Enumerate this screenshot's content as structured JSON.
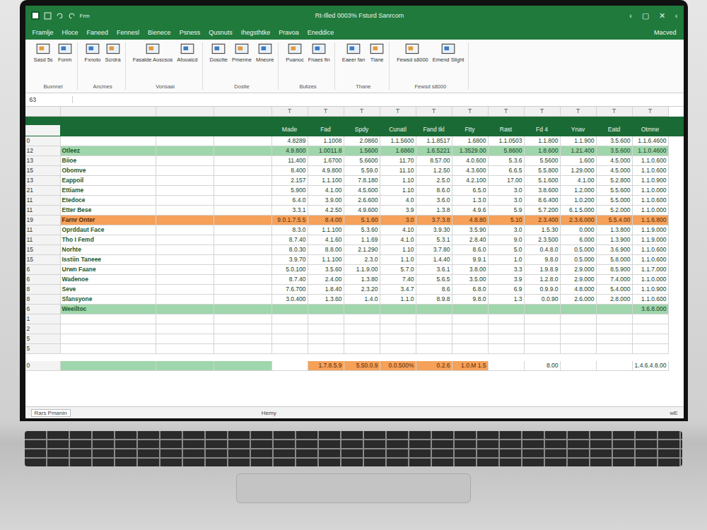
{
  "window": {
    "title": "Rt-Illed 0003% Fsturd Sanrcom",
    "controls": [
      "‹",
      "▢",
      "✕",
      "‹"
    ],
    "account": "Macved"
  },
  "quick_access": [
    "Frm"
  ],
  "tabs": [
    {
      "label": "Framlje",
      "selected": false
    },
    {
      "label": "Hloce",
      "selected": false
    },
    {
      "label": "Faneed",
      "selected": false
    },
    {
      "label": "Fennesl",
      "selected": false
    },
    {
      "label": "Bienece",
      "selected": false
    },
    {
      "label": "Psness",
      "selected": false
    },
    {
      "label": "Qusnuts",
      "selected": false
    },
    {
      "label": "Ihegsthtke",
      "selected": false
    },
    {
      "label": "Pravoa",
      "selected": false
    },
    {
      "label": "Eneddice",
      "selected": false
    }
  ],
  "ribbon": [
    {
      "group": "Buxnnel",
      "items": [
        "Sasd 5s",
        "Fonm"
      ]
    },
    {
      "group": "Ancmes",
      "items": [
        "Fxnoto",
        "Scrdra"
      ]
    },
    {
      "group": "Vonsaai",
      "items": [
        "Fasalde Aoscsos",
        "Afooaicd"
      ]
    },
    {
      "group": "Dostie",
      "items": [
        "Dosctte",
        "Pmenne",
        "Mneore"
      ]
    },
    {
      "group": "Bulizes",
      "items": [
        "Puanoc",
        "Fnaes fin"
      ]
    },
    {
      "group": "Thane",
      "items": [
        "Eaeer fan",
        "Tlane"
      ]
    },
    {
      "group": "Fewsd s8000",
      "items": [
        "Fewsd s8000",
        "Emend Slight"
      ]
    }
  ],
  "formula_bar": {
    "name_box": "63",
    "formula": ""
  },
  "column_letters": [
    "",
    "",
    "",
    "",
    "T",
    "T",
    "T",
    "T",
    "T",
    "T",
    "T",
    "T",
    "T",
    "T",
    "T"
  ],
  "table": {
    "columns": [
      "Made",
      "Fad",
      "Spdy",
      "Cunatl",
      "Fand tkl",
      "Ftty",
      "Rast",
      "Fd 4",
      "Ynav",
      "Eatd",
      "Otmne"
    ],
    "rows": [
      {
        "number": "0",
        "label": "",
        "kind": "normal",
        "cells": [
          "4.8289",
          "1.1008",
          "2.0860",
          "1.1.5600",
          "1.1.8517",
          "1.6800",
          "1.1.0503",
          "1.1.800",
          "1.1.900",
          "3.5.600",
          "1.1.6.4600"
        ]
      },
      {
        "number": "12",
        "label": "Otleez",
        "kind": "green",
        "cells": [
          "4.9.800",
          "1.0011.8",
          "1.5600",
          "1.6860",
          "1.6.5221",
          "1.3529.00",
          "5.8600",
          "1.8.600",
          "1.21.400",
          "3.5.600",
          "1.1.0.4600"
        ]
      },
      {
        "number": "13",
        "label": "Biioe",
        "kind": "normal",
        "cells": [
          "11.400",
          "1.6700",
          "5.6600",
          "11.70",
          "8.57.00",
          "4.0.600",
          "5.3.6",
          "5.5600",
          "1.600",
          "4.5.000",
          "1.1.0.600"
        ]
      },
      {
        "number": "15",
        "label": "Obomve",
        "kind": "normal",
        "cells": [
          "8.400",
          "4.9.800",
          "5.59.0",
          "11.10",
          "1.2.50",
          "4.3.600",
          "6.6.5",
          "5.5.800",
          "1.29.000",
          "4.5.000",
          "1.1.0.600"
        ]
      },
      {
        "number": "13",
        "label": "Eappoil",
        "kind": "normal",
        "cells": [
          "2.157",
          "1.1.100",
          "7.8.180",
          "1.10",
          "2.5.0",
          "4.2.100",
          "17.00",
          "5.1.600",
          "4.1.00",
          "5.2.800",
          "1.1.0.900"
        ]
      },
      {
        "number": "21",
        "label": "Ettiame",
        "kind": "normal",
        "cells": [
          "5.900",
          "4.1.00",
          "4.5.600",
          "1.10",
          "8.6.0",
          "6.5.0",
          "3.0",
          "3.8.600",
          "1.2.000",
          "5.5.600",
          "1.1.0.000"
        ]
      },
      {
        "number": "11",
        "label": "Etedoce",
        "kind": "normal",
        "cells": [
          "6.4.0",
          "3.9.00",
          "2.6.600",
          "4.0",
          "3.6.0",
          "1.3.0",
          "3.0",
          "8.6.400",
          "1.0.200",
          "5.5.000",
          "1.1.0.600"
        ]
      },
      {
        "number": "11",
        "label": "Etter Bese",
        "kind": "normal",
        "cells": [
          "3.3.1",
          "4.2.50",
          "4.9.600",
          "3.9",
          "1.3.8",
          "4.9.6",
          "5.9",
          "5.7.200",
          "6.1.5.000",
          "5.2.000",
          "1.1.0.000"
        ]
      },
      {
        "number": "19",
        "label": "Farnr Onter",
        "kind": "orange",
        "cells": [
          "9.0.1.7.5.5",
          "8.4.00",
          "5.1.60",
          "3.0",
          "3.7.3.8",
          "4.8.80",
          "5.10",
          "2.3.400",
          "2.3.6.000",
          "5.5.4.00",
          "1.1.6.800"
        ]
      },
      {
        "number": "11",
        "label": "Oprddaut Face",
        "kind": "normal",
        "cells": [
          "8.3.0",
          "1.1.100",
          "5.3.60",
          "4.10",
          "3.9.30",
          "3.5.90",
          "3.0",
          "1.5.30",
          "0.000",
          "1.3.800",
          "1.1.9.000"
        ]
      },
      {
        "number": "11",
        "label": "Tho I Femd",
        "kind": "normal",
        "cells": [
          "8.7.40",
          "4.1.60",
          "1.1.69",
          "4.1.0",
          "5.3.1",
          "2.8.40",
          "9.0",
          "2.3.500",
          "6.000",
          "1.3.900",
          "1.1.9.000"
        ]
      },
      {
        "number": "15",
        "label": "Norhte",
        "kind": "normal",
        "cells": [
          "8.0.30",
          "8.8.00",
          "2.1.290",
          "1.10",
          "3.7.80",
          "8.6.0",
          "5.0",
          "0.4.8.0",
          "0.5.000",
          "3.6.900",
          "1.1.0.600"
        ]
      },
      {
        "number": "15",
        "label": "Isstiin Taneee",
        "kind": "normal",
        "cells": [
          "3.9.70",
          "1.1.100",
          "2.3.0",
          "1.1.0",
          "1.4.40",
          "9.9.1",
          "1.0",
          "9.8.0",
          "0.5.000",
          "5.8.000",
          "1.1.0.600"
        ]
      },
      {
        "number": "6",
        "label": "Urwn Faane",
        "kind": "normal",
        "cells": [
          "5.0.100",
          "3.5.60",
          "1.1.9.00",
          "5.7.0",
          "3.6.1",
          "3.8.00",
          "3.3",
          "1.9.8.9",
          "2.9.000",
          "8.5.900",
          "1.1.7.000"
        ]
      },
      {
        "number": "6",
        "label": "Wadenoe",
        "kind": "normal",
        "cells": [
          "8.7.40",
          "2.4.00",
          "1.3.80",
          "7.40",
          "5.6.5",
          "3.5.00",
          "3.9",
          "1.2.8.0",
          "2.9.000",
          "7.4.000",
          "1.1.0.000"
        ]
      },
      {
        "number": "8",
        "label": "Seve",
        "kind": "normal",
        "cells": [
          "7.6.700",
          "1.8.40",
          "2.3.20",
          "3.4.7",
          "8.6",
          "6.8.0",
          "6.9",
          "0.9.9.0",
          "4.8.000",
          "5.4.000",
          "1.1.0.900"
        ]
      },
      {
        "number": "8",
        "label": "Sfansyone",
        "kind": "normal",
        "cells": [
          "3.0.400",
          "1.3.60",
          "1.4.0",
          "1.1.0",
          "8.9.8",
          "9.8.0",
          "1.3",
          "0.0.90",
          "2.6.000",
          "2.8.000",
          "1.1.0.600"
        ]
      },
      {
        "number": "6",
        "label": "Weeiltoc",
        "kind": "green",
        "cells": [
          "",
          "",
          "",
          "",
          "",
          "",
          "",
          "",
          "",
          "",
          "3.6.8.000"
        ]
      },
      {
        "number": "1",
        "label": "",
        "kind": "empty",
        "cells": [
          "",
          "",
          "",
          "",
          "",
          "",
          "",
          "",
          "",
          "",
          ""
        ]
      },
      {
        "number": "2",
        "label": "",
        "kind": "empty",
        "cells": [
          "",
          "",
          "",
          "",
          "",
          "",
          "",
          "",
          "",
          "",
          ""
        ]
      },
      {
        "number": "5",
        "label": "",
        "kind": "empty",
        "cells": [
          "",
          "",
          "",
          "",
          "",
          "",
          "",
          "",
          "",
          "",
          ""
        ]
      },
      {
        "number": "5",
        "label": "",
        "kind": "empty",
        "cells": [
          "",
          "",
          "",
          "",
          "",
          "",
          "",
          "",
          "",
          "",
          ""
        ]
      }
    ],
    "summary": {
      "number": "0",
      "label": "",
      "cells": [
        {
          "text": "",
          "highlighted": false
        },
        {
          "text": "1.7.8.5.9",
          "highlighted": true
        },
        {
          "text": "5.50.0.9",
          "highlighted": true
        },
        {
          "text": "0.0.500%",
          "highlighted": true
        },
        {
          "text": "0.2.6",
          "highlighted": true
        },
        {
          "text": "1.0.M 1.5",
          "highlighted": true
        },
        {
          "text": "",
          "highlighted": false
        },
        {
          "text": "8.00",
          "highlighted": false
        },
        {
          "text": "",
          "highlighted": false
        },
        {
          "text": "",
          "highlighted": false
        },
        {
          "text": "1.4.6.4.8.00",
          "highlighted": false
        }
      ]
    }
  },
  "sheet_tabs": [
    {
      "label": "Rars Pmanin",
      "selected": true
    }
  ],
  "status_bar": {
    "text": "Hemy",
    "zoom": "wE"
  }
}
